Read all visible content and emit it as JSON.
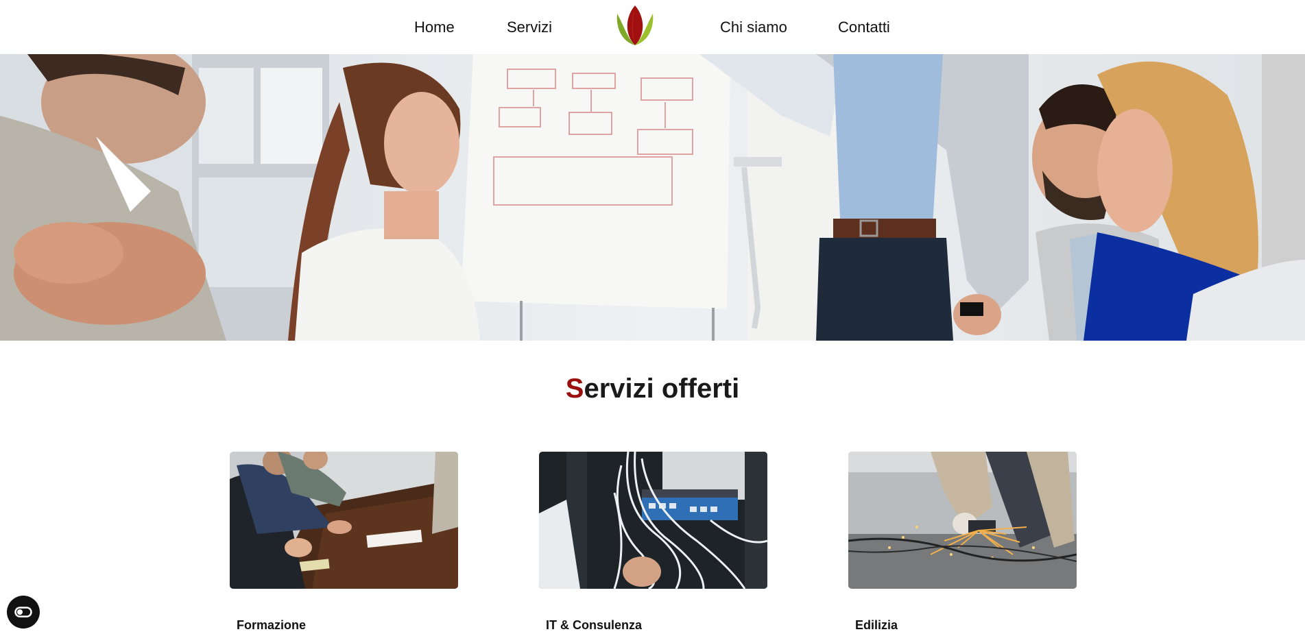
{
  "nav": {
    "items": [
      {
        "label": "Home"
      },
      {
        "label": "Servizi"
      },
      {
        "label": "Chi siamo"
      },
      {
        "label": "Contatti"
      }
    ],
    "logo_icon": "lotus-logo-icon"
  },
  "section": {
    "title_first": "S",
    "title_rest": "ervizi offerti"
  },
  "cards": [
    {
      "label": "Formazione",
      "image": "meeting-table-photo"
    },
    {
      "label": "IT & Consulenza",
      "image": "network-switch-cables-photo"
    },
    {
      "label": "Edilizia",
      "image": "angle-grinder-sparks-photo"
    }
  ],
  "accessibility": {
    "icon": "accessibility-toggle-icon"
  },
  "colors": {
    "accent": "#9b0e0e",
    "logo_red": "#a01010",
    "logo_green": "#7fa828",
    "text": "#111111",
    "background": "#ffffff"
  }
}
